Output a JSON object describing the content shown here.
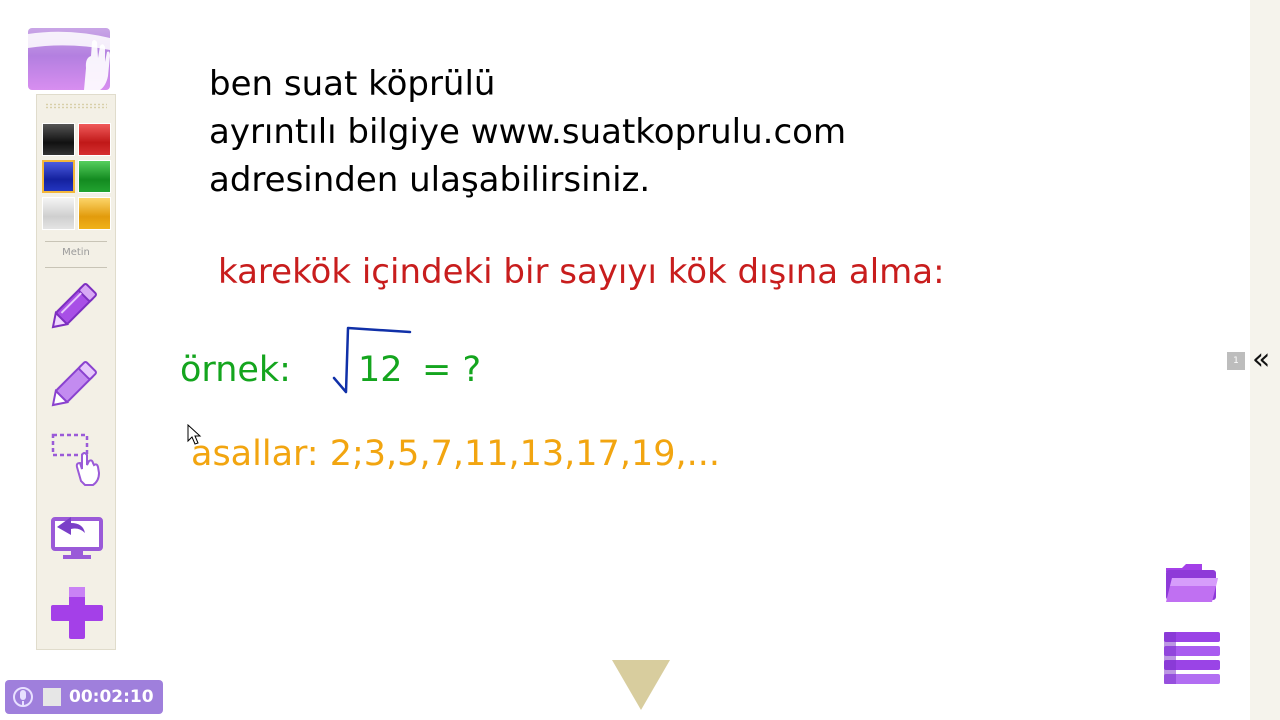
{
  "content": {
    "intro_lines": [
      "ben suat köprülü",
      "ayrıntılı bilgiye www.suatkoprulu.com",
      "adresinden ulaşabilirsiniz."
    ],
    "heading": "karekök içindeki bir sayıyı kök dışına alma:",
    "example_label": "örnek:",
    "example_radicand": "12",
    "example_rest": "= ?",
    "primes": "asallar: 2;3,5,7,11,13,17,19,..."
  },
  "toolbar": {
    "section_label": "Metin",
    "colors": [
      "#1a1a1a",
      "#d42020",
      "#1c2fb8",
      "#1f9c2c",
      "#e2e2e2",
      "#f0b21a"
    ],
    "selected_color_index": 2,
    "tools": [
      "pen-tool",
      "highlighter-tool",
      "select-tool",
      "screen-capture-tool",
      "add-tool"
    ]
  },
  "timer": {
    "time": "00:02:10"
  },
  "pager": {
    "page": "1",
    "collapse_glyph": "«"
  },
  "colors": {
    "accent_purple": "#a26be0",
    "text_red": "#c81d1d",
    "text_green": "#14a51e",
    "text_orange": "#f2a510",
    "ink_blue": "#1030a8"
  }
}
